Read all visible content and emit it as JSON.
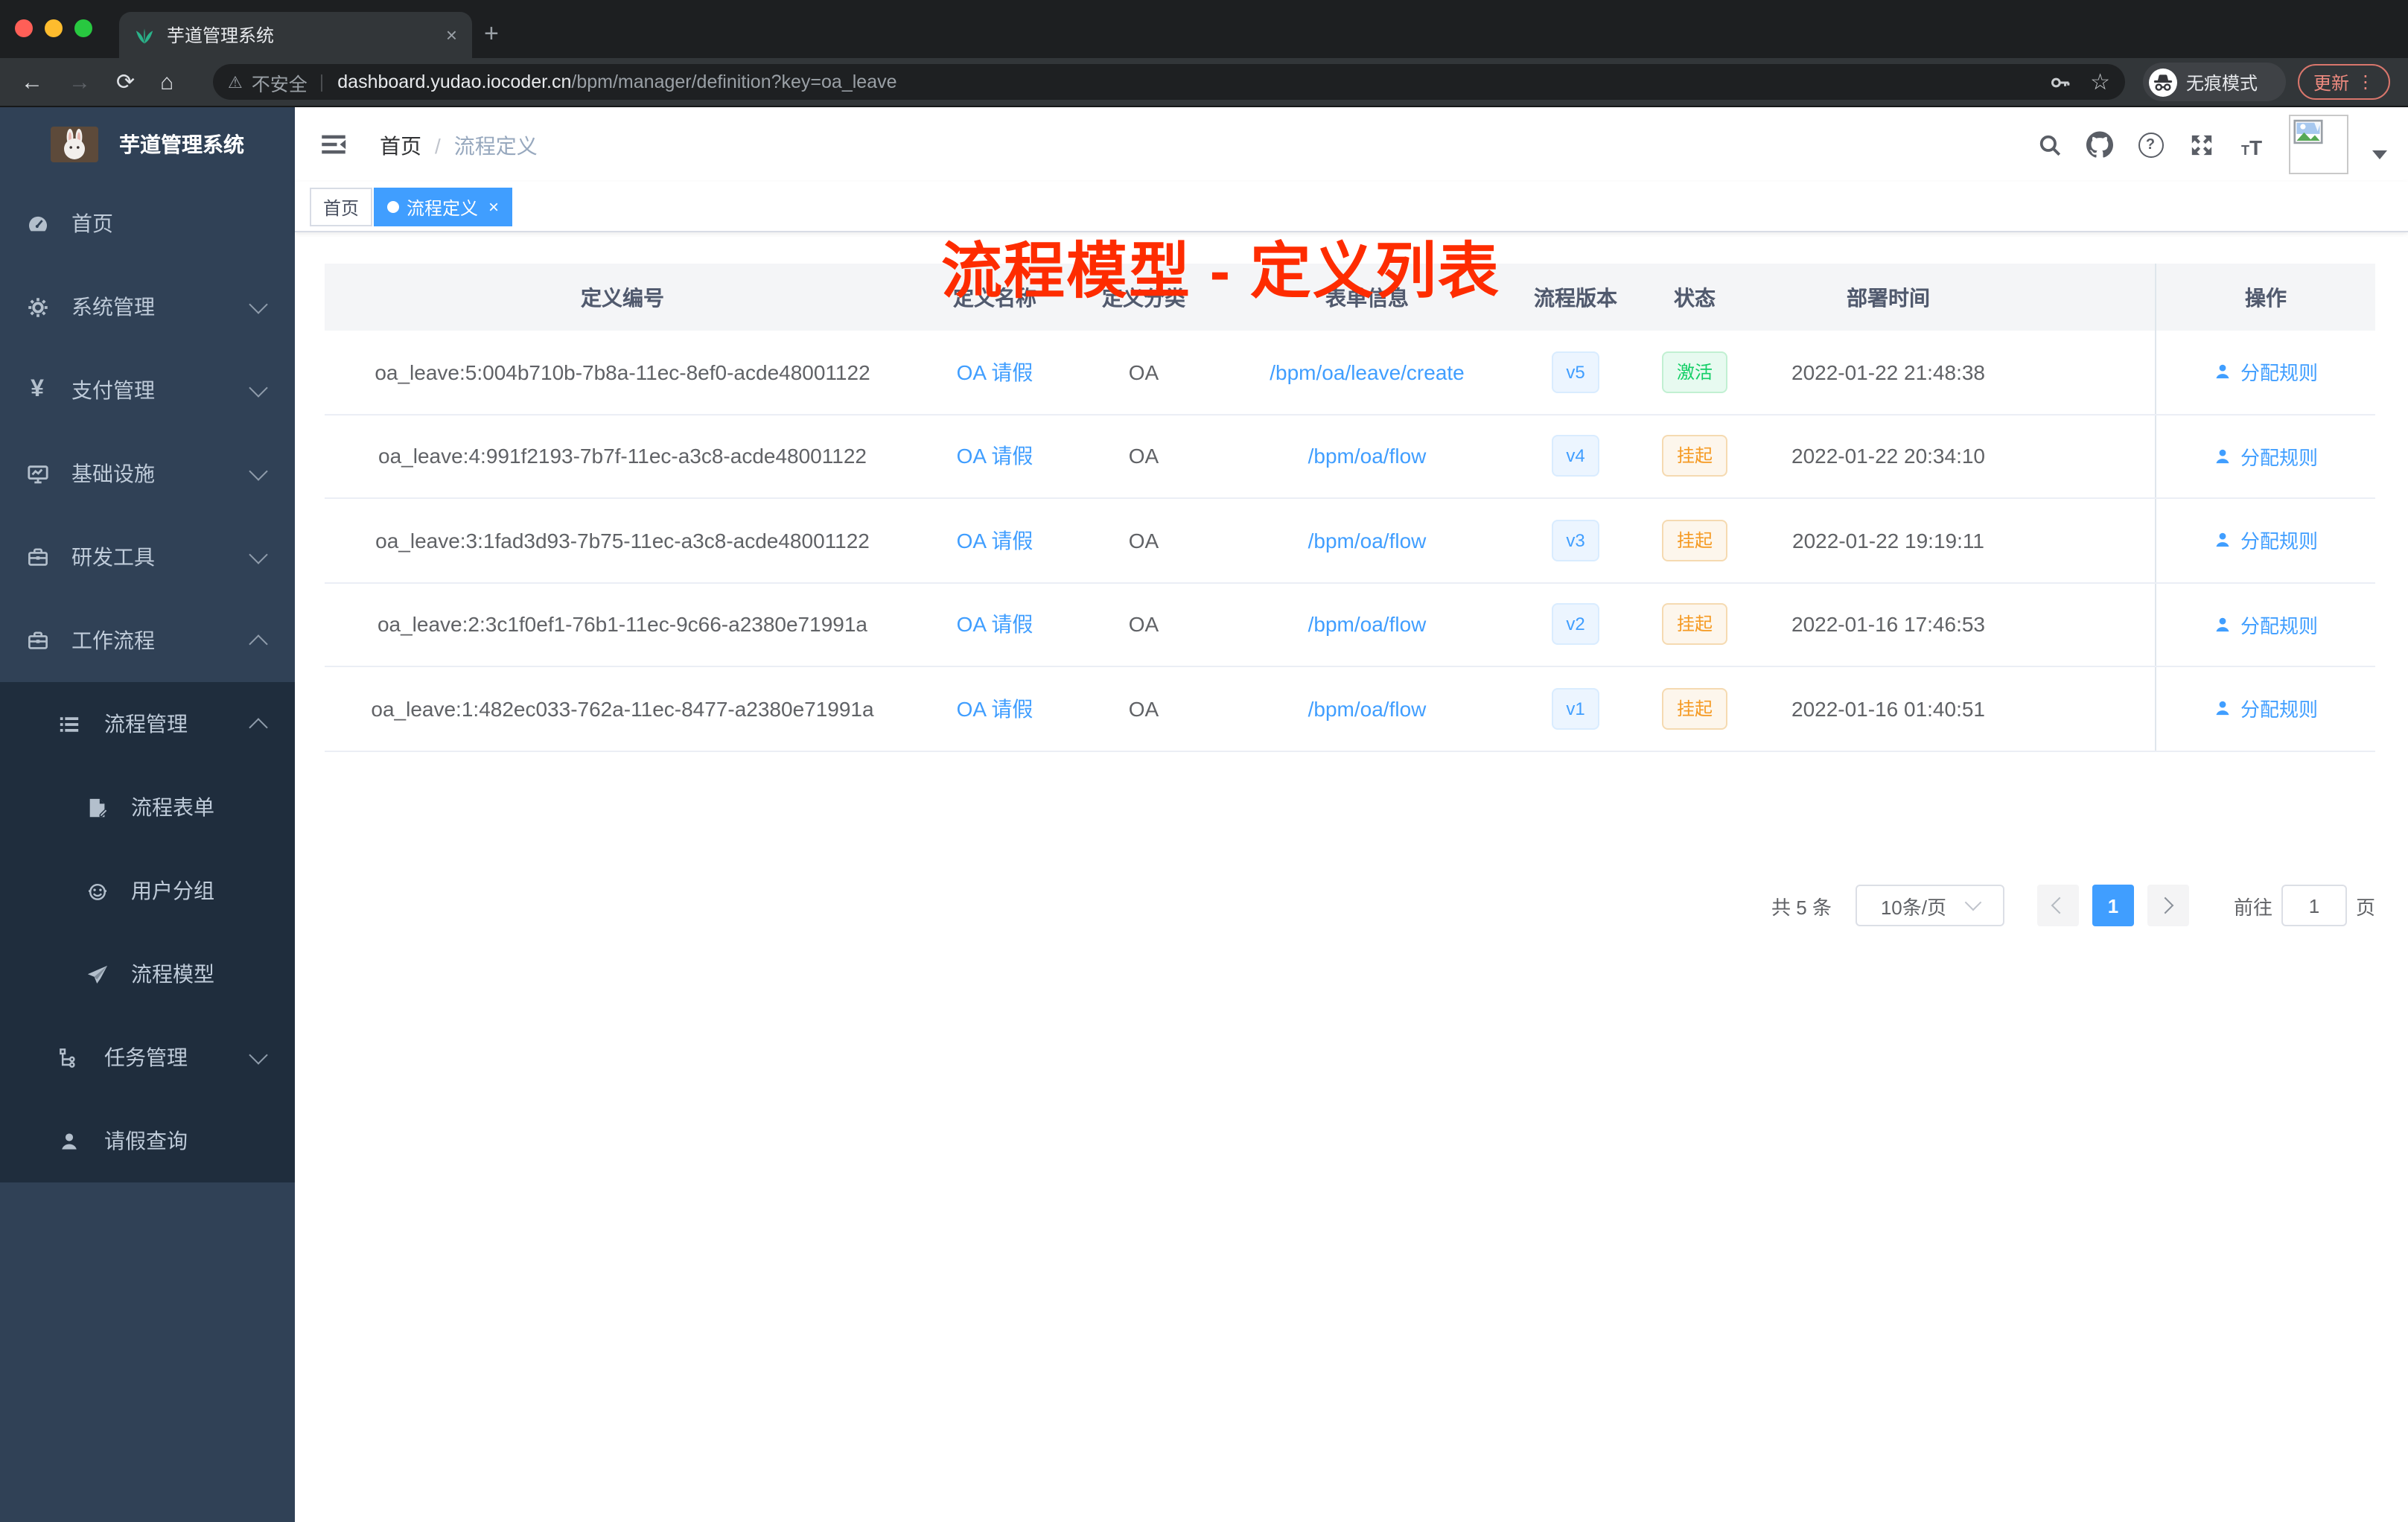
{
  "browser": {
    "tab_title": "芋道管理系统",
    "security_label": "不安全",
    "url_host": "dashboard.yudao.iocoder.cn",
    "url_path": "/bpm/manager/definition?key=oa_leave",
    "incognito_label": "无痕模式",
    "update_label": "更新"
  },
  "icons": {
    "close": "×",
    "plus": "+",
    "back": "←",
    "forward": "→",
    "reload": "⟳",
    "home": "⌂",
    "warning": "⚠",
    "divider": "|",
    "star": "☆",
    "more": "⋮",
    "question": "?",
    "font_small": "T",
    "font_large": "T"
  },
  "sidebar": {
    "logo_title": "芋道管理系统",
    "items": [
      {
        "label": "首页"
      },
      {
        "label": "系统管理"
      },
      {
        "label": "支付管理"
      },
      {
        "label": "基础设施"
      },
      {
        "label": "研发工具"
      },
      {
        "label": "工作流程"
      },
      {
        "label": "流程管理"
      },
      {
        "label": "流程表单"
      },
      {
        "label": "用户分组"
      },
      {
        "label": "流程模型"
      },
      {
        "label": "任务管理"
      },
      {
        "label": "请假查询"
      }
    ]
  },
  "navbar": {
    "breadcrumb_home": "首页",
    "breadcrumb_separator": "/",
    "breadcrumb_current": "流程定义"
  },
  "tags": {
    "home_label": "首页",
    "active_label": "流程定义"
  },
  "annotation": {
    "title": "流程模型 - 定义列表",
    "color": "#fe2c00"
  },
  "table": {
    "headers": [
      "定义编号",
      "定义名称",
      "定义分类",
      "表单信息",
      "流程版本",
      "状态",
      "部署时间",
      "操作"
    ],
    "action_label": "分配规则",
    "rows": [
      {
        "id": "oa_leave:5:004b710b-7b8a-11ec-8ef0-acde48001122",
        "name": "OA 请假",
        "category": "OA",
        "form": "/bpm/oa/leave/create",
        "version": "v5",
        "status": "激活",
        "deploy_time": "2022-01-22 21:48:38"
      },
      {
        "id": "oa_leave:4:991f2193-7b7f-11ec-a3c8-acde48001122",
        "name": "OA 请假",
        "category": "OA",
        "form": "/bpm/oa/flow",
        "version": "v4",
        "status": "挂起",
        "deploy_time": "2022-01-22 20:34:10"
      },
      {
        "id": "oa_leave:3:1fad3d93-7b75-11ec-a3c8-acde48001122",
        "name": "OA 请假",
        "category": "OA",
        "form": "/bpm/oa/flow",
        "version": "v3",
        "status": "挂起",
        "deploy_time": "2022-01-22 19:19:11"
      },
      {
        "id": "oa_leave:2:3c1f0ef1-76b1-11ec-9c66-a2380e71991a",
        "name": "OA 请假",
        "category": "OA",
        "form": "/bpm/oa/flow",
        "version": "v2",
        "status": "挂起",
        "deploy_time": "2022-01-16 17:46:53"
      },
      {
        "id": "oa_leave:1:482ec033-762a-11ec-8477-a2380e71991a",
        "name": "OA 请假",
        "category": "OA",
        "form": "/bpm/oa/flow",
        "version": "v1",
        "status": "挂起",
        "deploy_time": "2022-01-16 01:40:51"
      }
    ]
  },
  "pagination": {
    "total": "共 5 条",
    "page_size": "10条/页",
    "current_page": "1",
    "jump_prefix": "前往",
    "jump_value": "1",
    "jump_suffix": "页"
  },
  "colors": {
    "accent_blue": "#409eff",
    "annotation_red": "#fe2c00",
    "status_active_green": "#13ce66",
    "status_suspend_orange": "#f59a23",
    "sidebar_bg": "#304156",
    "submenu_bg": "#1f2d3d"
  }
}
